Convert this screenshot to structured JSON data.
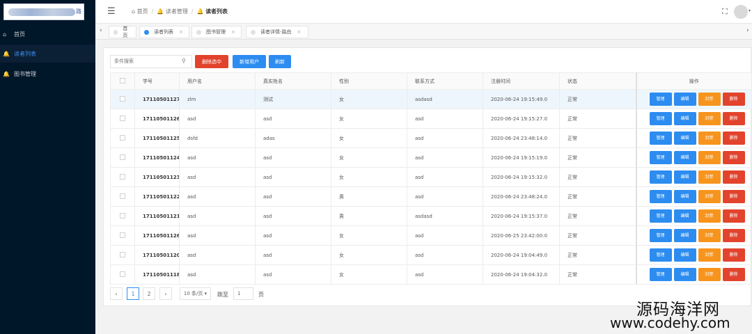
{
  "sidebar": {
    "logo_text": "路",
    "items": [
      {
        "label": "首页",
        "icon": "home-icon"
      },
      {
        "label": "读者列表",
        "icon": "bell-icon"
      },
      {
        "label": "图书管理",
        "icon": "bell-icon"
      }
    ],
    "active_index": 1
  },
  "header": {
    "breadcrumb": [
      "首页",
      "读者管理",
      "读者列表"
    ]
  },
  "tabs": [
    {
      "label": "首页",
      "active": false,
      "closable": false
    },
    {
      "label": "读者列表",
      "active": true,
      "closable": true
    },
    {
      "label": "图书管理",
      "active": false,
      "closable": true
    },
    {
      "label": "读者详情-路由",
      "active": false,
      "closable": true
    }
  ],
  "toolbar": {
    "search_placeholder": "条件搜索",
    "delete_selected": "删除选中",
    "add_user": "新增用户",
    "refresh": "刷新"
  },
  "table": {
    "columns": [
      "学号",
      "用户名",
      "真实姓名",
      "性别",
      "联系方式",
      "注册时间",
      "状态",
      "操作"
    ],
    "actions": [
      "管理",
      "编辑",
      "封禁",
      "删除"
    ],
    "rows": [
      {
        "id": "17110501127",
        "username": "zlm",
        "realname": "测试",
        "gender": "女",
        "contact": "asdasd",
        "reg_time": "2020-06-24 19:15:49.0",
        "status": "正常"
      },
      {
        "id": "17110501126",
        "username": "asd",
        "realname": "asd",
        "gender": "女",
        "contact": "asd",
        "reg_time": "2020-06-24 19:15:27.0",
        "status": "正常"
      },
      {
        "id": "17110501125",
        "username": "dsfd",
        "realname": "adas",
        "gender": "女",
        "contact": "asd",
        "reg_time": "2020-06-24 23:48:14.0",
        "status": "正常"
      },
      {
        "id": "17110501124",
        "username": "asd",
        "realname": "asd",
        "gender": "女",
        "contact": "asd",
        "reg_time": "2020-06-24 19:15:19.0",
        "status": "正常"
      },
      {
        "id": "17110501123",
        "username": "asd",
        "realname": "asd",
        "gender": "女",
        "contact": "asd",
        "reg_time": "2020-06-24 19:15:32.0",
        "status": "正常"
      },
      {
        "id": "17110501122",
        "username": "asd",
        "realname": "asd",
        "gender": "男",
        "contact": "asd",
        "reg_time": "2020-06-24 23:48:24.0",
        "status": "正常"
      },
      {
        "id": "17110501121",
        "username": "asd",
        "realname": "asd",
        "gender": "男",
        "contact": "asdasd",
        "reg_time": "2020-06-24 19:15:37.0",
        "status": "正常"
      },
      {
        "id": "17110501126",
        "username": "asd",
        "realname": "asd",
        "gender": "女",
        "contact": "asd",
        "reg_time": "2020-06-25 23:42:00.0",
        "status": "正常"
      },
      {
        "id": "17110501120",
        "username": "asd",
        "realname": "asd",
        "gender": "女",
        "contact": "asd",
        "reg_time": "2020-06-24 19:04:49.0",
        "status": "正常"
      },
      {
        "id": "17110501118",
        "username": "asd",
        "realname": "asd",
        "gender": "女",
        "contact": "asd",
        "reg_time": "2020-06-24 19:04:32.0",
        "status": "正常"
      }
    ]
  },
  "pagination": {
    "prev": "‹",
    "pages": [
      "1",
      "2"
    ],
    "current": "1",
    "next": "›",
    "page_size": "10 条/页",
    "goto_label": "跳至",
    "goto_value": "1",
    "page_suffix": "页"
  },
  "watermark": {
    "line1": "源码海洋网",
    "line2": "www.codehy.com"
  },
  "colors": {
    "sidebar_bg": "#001629",
    "primary": "#2d8cf0",
    "danger": "#e2432c",
    "warning": "#f7941d"
  }
}
